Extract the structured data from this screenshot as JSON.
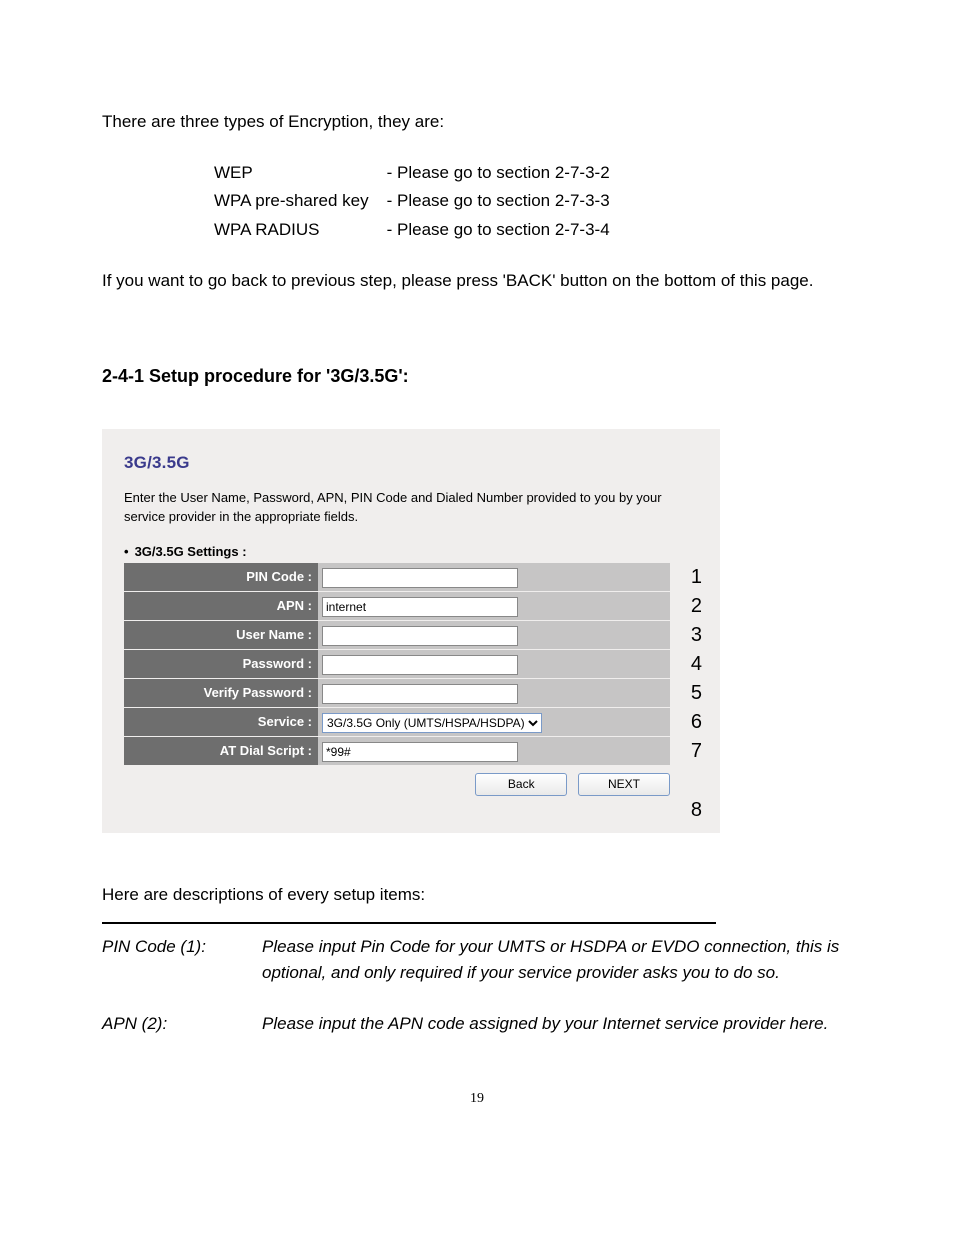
{
  "intro": "There are three types of Encryption, they are:",
  "enc_types": [
    {
      "name": "WEP",
      "ref": "- Please go to section 2-7-3-2"
    },
    {
      "name": "WPA pre-shared key",
      "ref": "- Please go to section 2-7-3-3"
    },
    {
      "name": "WPA RADIUS",
      "ref": "- Please go to section 2-7-3-4"
    }
  ],
  "back_note": "If you want to go back to previous step, please press 'BACK' button on the bottom of this page.",
  "section_heading": "2-4-1 Setup procedure for '3G/3.5G':",
  "panel": {
    "title": "3G/3.5G",
    "desc": "Enter the User Name, Password, APN, PIN Code and Dialed Number provided to you by your service provider in the appropriate fields.",
    "subhead": "3G/3.5G Settings :",
    "fields": [
      {
        "label": "PIN Code :",
        "type": "text",
        "value": "",
        "num": "1"
      },
      {
        "label": "APN :",
        "type": "text",
        "value": "internet",
        "num": "2"
      },
      {
        "label": "User Name :",
        "type": "text",
        "value": "",
        "num": "3"
      },
      {
        "label": "Password :",
        "type": "password",
        "value": "",
        "num": "4"
      },
      {
        "label": "Verify Password :",
        "type": "password",
        "value": "",
        "num": "5"
      },
      {
        "label": "Service :",
        "type": "select",
        "value": "3G/3.5G Only (UMTS/HSPA/HSDPA)",
        "num": "6"
      },
      {
        "label": "AT Dial Script :",
        "type": "text",
        "value": "*99#",
        "num": "7"
      }
    ],
    "back_btn": "Back",
    "next_btn": "NEXT",
    "num8": "8"
  },
  "desc_intro": "Here are descriptions of every setup items:",
  "desc_rows": [
    {
      "label": "PIN Code (1):",
      "text": "Please input Pin Code for your UMTS or HSDPA or EVDO connection, this is optional, and only required if your service provider asks you to do so."
    },
    {
      "label": "APN (2):",
      "text": "Please input the APN code assigned by your Internet service provider here."
    }
  ],
  "page_number": "19"
}
